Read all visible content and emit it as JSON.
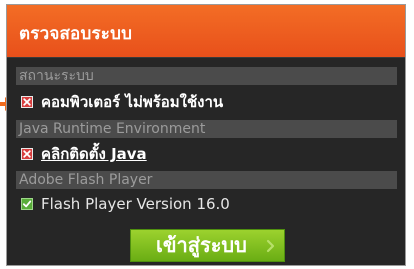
{
  "colors": {
    "header_orange": "#f05f20",
    "panel_bg": "#262626",
    "section_bar": "#4b4b4b",
    "section_text": "#9b9b9b",
    "fail_red": "#d73f3f",
    "ok_green": "#59ad3a",
    "button_green": "#84c022",
    "arrow_orange": "#f06a1c"
  },
  "panel": {
    "title": "ตรวจสอบระบบ"
  },
  "sections": [
    {
      "heading": "สถานะระบบ",
      "status": "fail",
      "icon": "close-icon",
      "text": "คอมพิวเตอร์ ไม่พร้อมใช้งาน"
    },
    {
      "heading": "Java Runtime Environment",
      "status": "fail",
      "icon": "close-icon",
      "text": "คลิกติดตั้ง Java"
    },
    {
      "heading": "Adobe Flash Player",
      "status": "ok",
      "icon": "checkmark-icon",
      "text": "Flash Player Version 16.0"
    }
  ],
  "login_button": {
    "label": "เข้าสู่ระบบ",
    "icon": "chevron-right-icon"
  },
  "pointer": {
    "icon": "arrow-right-icon"
  }
}
